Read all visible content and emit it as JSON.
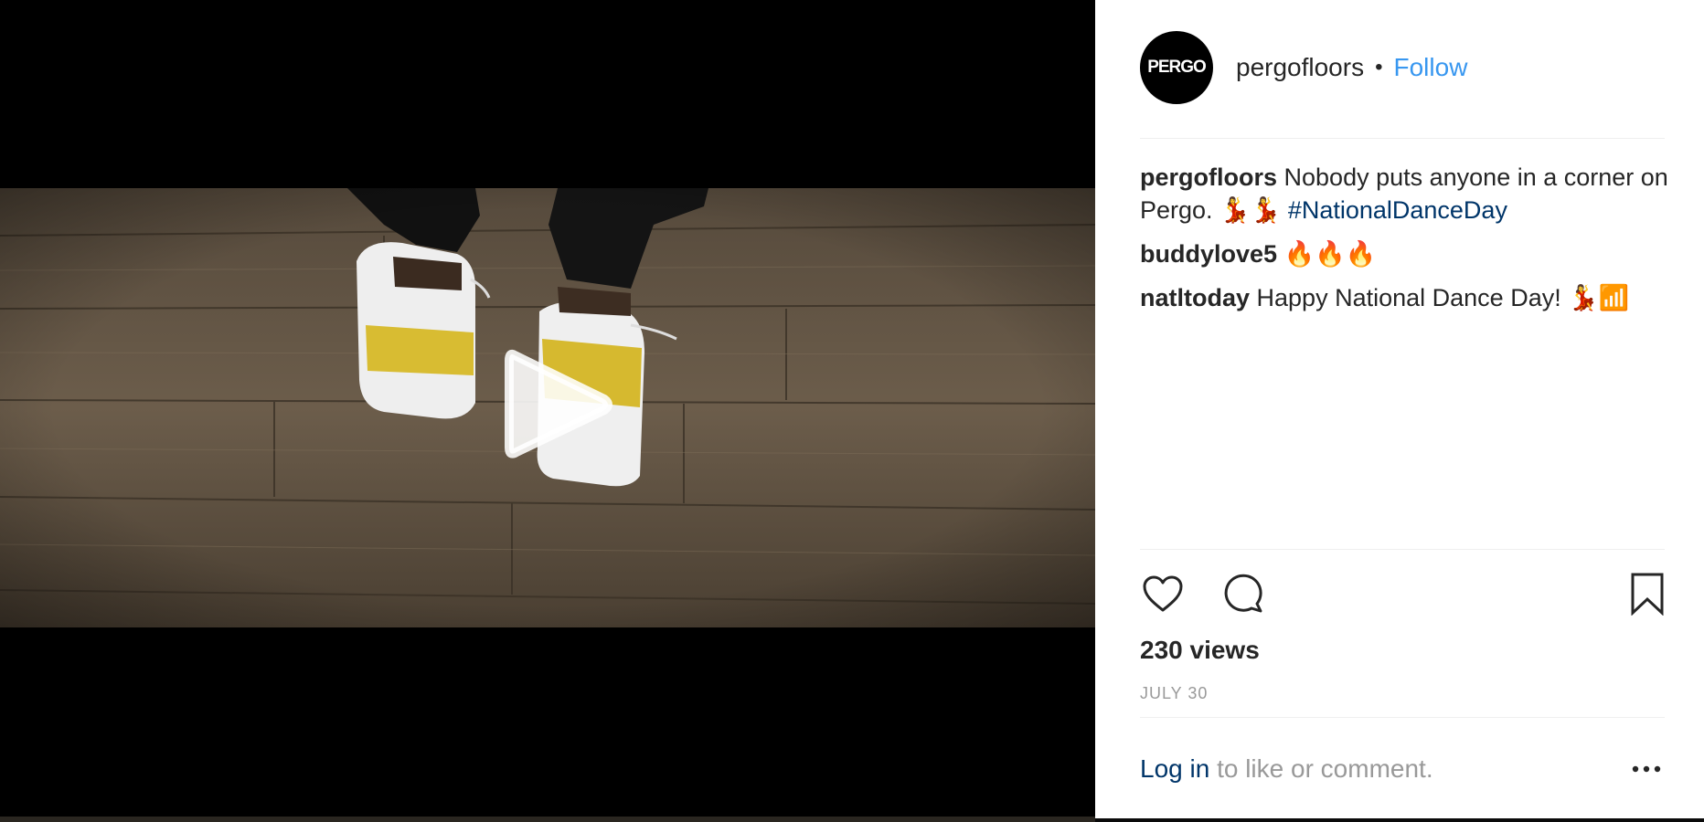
{
  "post": {
    "username": "pergofloors",
    "avatar_text": "PERGO",
    "separator": "•",
    "follow_label": "Follow"
  },
  "comments": [
    {
      "user": "pergofloors",
      "text": "Nobody puts anyone in a corner on Pergo. 💃💃",
      "hashtag": "#NationalDanceDay"
    },
    {
      "user": "buddylove5",
      "text": "🔥🔥🔥"
    },
    {
      "user": "natltoday",
      "text": "Happy National Dance Day! 💃📶"
    }
  ],
  "stats": {
    "views": "230 views",
    "date": "JULY 30"
  },
  "footer": {
    "login_link": "Log in",
    "login_text": " to like or comment.",
    "more_label": "•••"
  },
  "icons": {
    "play": "play-icon",
    "heart": "heart-icon",
    "comment": "comment-icon",
    "bookmark": "bookmark-icon",
    "more": "more-icon"
  },
  "colors": {
    "link_blue": "#3897f0",
    "hashtag_blue": "#003569",
    "text": "#262626",
    "muted": "#999999",
    "divider": "#efefef"
  }
}
